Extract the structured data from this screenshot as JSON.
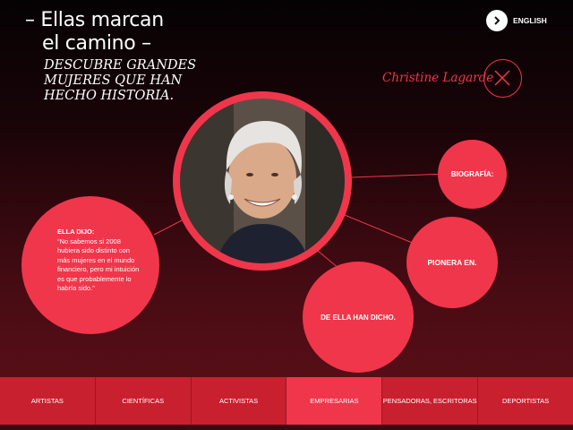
{
  "header": {
    "title_line1": "– Ellas marcan",
    "title_line2": "el camino –",
    "subtitle": "DESCUBRE GRANDES MUJERES QUE HAN HECHO HISTORIA.",
    "language_label": "ENGLISH"
  },
  "profile": {
    "name": "Christine Lagarde",
    "bubbles": {
      "biography": "BIOGRAFÍA:",
      "pioneer": "PIONERA EN.",
      "said_about": "DE ELLA HAN DICHO."
    },
    "quote": {
      "heading": "ELLA DIJO:",
      "text": "“No sabemos si 2008 hubiera sido distinto con más mujeres en el mundo financiero, pero mi intuición es que probablemente lo habría sido.”"
    }
  },
  "nav": {
    "items": [
      {
        "label": "ARTISTAS"
      },
      {
        "label": "CIENTÍFICAS"
      },
      {
        "label": "ACTIVISTAS"
      },
      {
        "label": "EMPRESARIAS"
      },
      {
        "label": "PENSADORAS, ESCRITORAS"
      },
      {
        "label": "DEPORTISTAS"
      }
    ],
    "active": "EMPRESARIAS"
  },
  "colors": {
    "accent": "#f0364b",
    "nav_bg": "#c8202f",
    "nav_active": "#f0364b"
  },
  "icons": {
    "language": "chevron-right-icon",
    "close": "close-icon"
  }
}
